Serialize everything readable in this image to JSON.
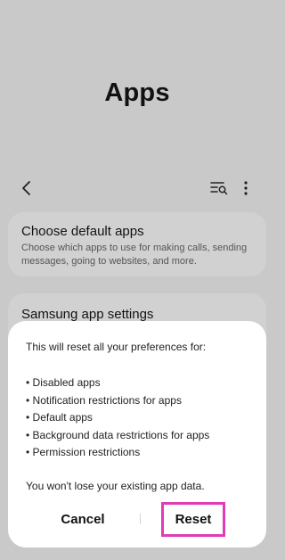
{
  "header": {
    "title": "Apps"
  },
  "toolbar": {
    "back_icon": "chevron-left-icon",
    "search_list_icon": "list-search-icon",
    "more_icon": "more-vertical-icon"
  },
  "cards": {
    "default_apps": {
      "title": "Choose default apps",
      "description": "Choose which apps to use for making calls, sending messages, going to websites, and more."
    },
    "samsung_settings": {
      "title": "Samsung app settings"
    }
  },
  "dialog": {
    "intro": "This will reset all your preferences for:",
    "items": [
      "• Disabled apps",
      "• Notification restrictions for apps",
      "• Default apps",
      "• Background data restrictions for apps",
      "• Permission restrictions"
    ],
    "note": "You won't lose your existing app data.",
    "cancel_label": "Cancel",
    "reset_label": "Reset",
    "highlight_color": "#e03cb4"
  }
}
